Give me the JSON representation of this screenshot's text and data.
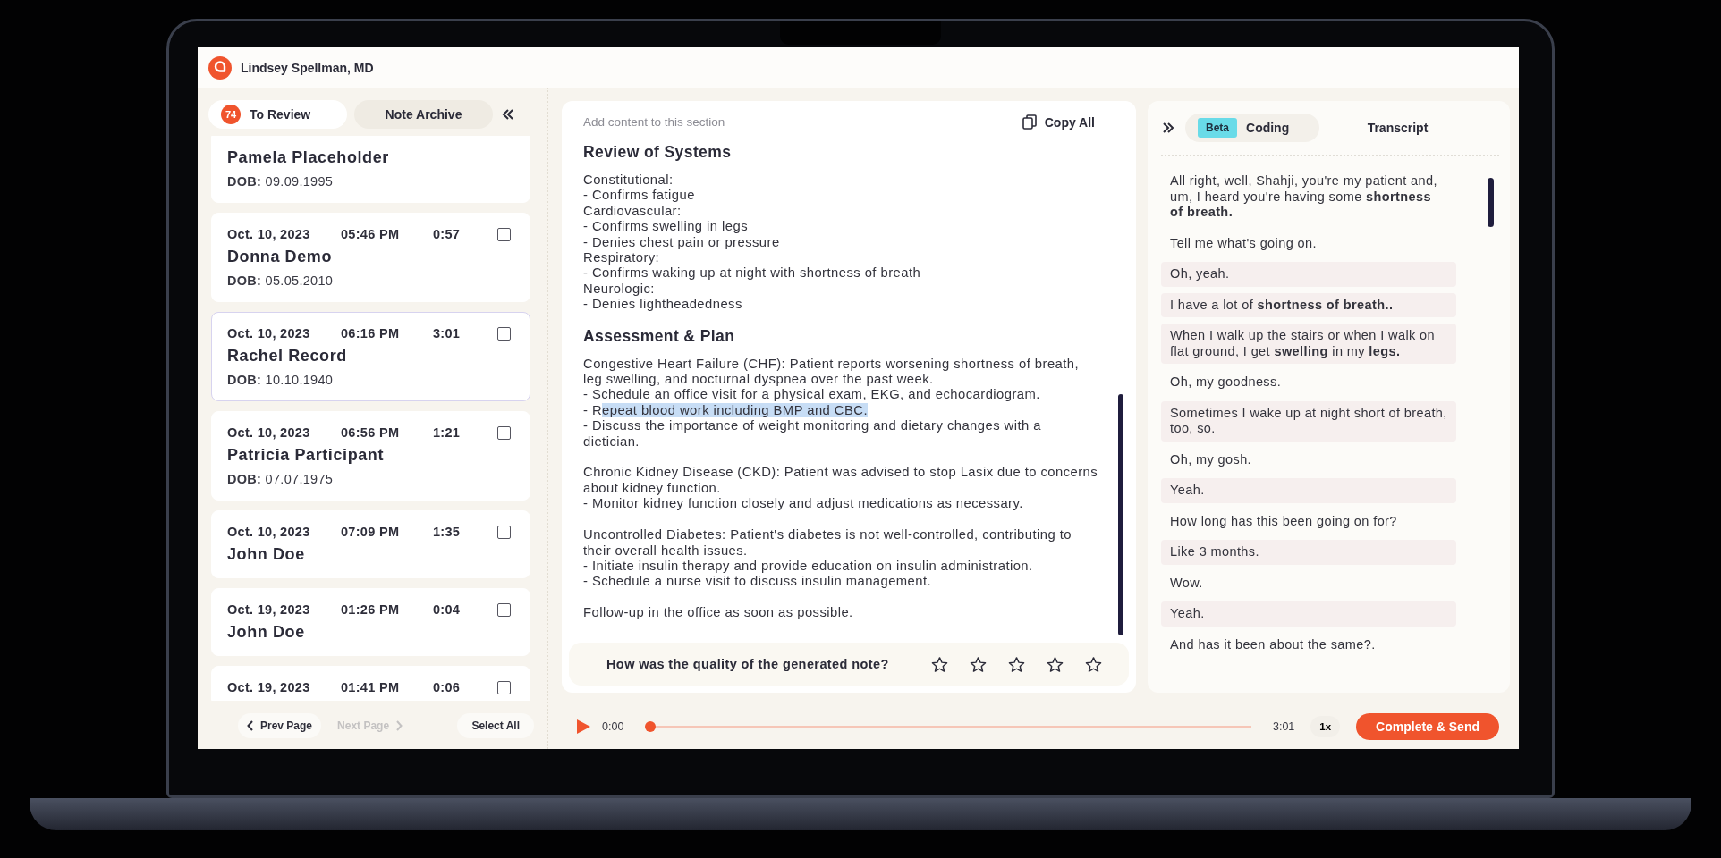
{
  "header": {
    "user_name": "Lindsey Spellman, MD"
  },
  "left_panel": {
    "tabs": [
      {
        "label": "To Review",
        "badge": "74",
        "selected": true
      },
      {
        "label": "Note Archive",
        "selected": false
      }
    ],
    "patients": [
      {
        "name": "Pamela Placeholder",
        "dob_label": "DOB:",
        "dob": "09.09.1995",
        "selected": false
      },
      {
        "date": "Oct. 10, 2023",
        "time": "05:46 PM",
        "duration": "0:57",
        "checked": false,
        "name": "Donna Demo",
        "dob_label": "DOB:",
        "dob": "05.05.2010",
        "selected": false
      },
      {
        "date": "Oct. 10, 2023",
        "time": "06:16 PM",
        "duration": "3:01",
        "checked": false,
        "name": "Rachel Record",
        "dob_label": "DOB:",
        "dob": "10.10.1940",
        "selected": true
      },
      {
        "date": "Oct. 10, 2023",
        "time": "06:56 PM",
        "duration": "1:21",
        "checked": false,
        "name": "Patricia Participant",
        "dob_label": "DOB:",
        "dob": "07.07.1975",
        "selected": false
      },
      {
        "date": "Oct. 10, 2023",
        "time": "07:09 PM",
        "duration": "1:35",
        "checked": false,
        "name": "John Doe",
        "selected": false
      },
      {
        "date": "Oct. 19, 2023",
        "time": "01:26 PM",
        "duration": "0:04",
        "checked": false,
        "name": "John Doe",
        "selected": false
      },
      {
        "date": "Oct. 19, 2023",
        "time": "01:41 PM",
        "duration": "0:06",
        "checked": false,
        "selected": false
      }
    ],
    "pager": {
      "prev": {
        "label": "Prev Page",
        "disabled": false
      },
      "next": {
        "label": "Next Page",
        "disabled": true
      },
      "select_all": "Select All"
    }
  },
  "note": {
    "placeholder": "Add content to this section",
    "copy_label": "Copy All",
    "sections": [
      {
        "heading": "Review of Systems",
        "paragraphs": [
          [
            "Constitutional:",
            "- Confirms fatigue",
            "Cardiovascular:",
            "- Confirms swelling in legs",
            "- Denies chest pain or pressure",
            "Respiratory:",
            "- Confirms waking up at night with shortness of breath",
            "Neurologic:",
            "- Denies lightheadedness"
          ]
        ]
      },
      {
        "heading": "Assessment & Plan",
        "paragraphs": [
          [
            "Congestive Heart Failure (CHF): Patient reports worsening shortness of breath, leg swelling, and nocturnal dyspnea over the past week.",
            "- Schedule an office visit for a physical exam, EKG, and echocardiogram.",
            {
              "text": "- R",
              "highlighted_text": "epeat blood work including BMP and CBC."
            },
            "- Discuss the importance of weight monitoring and dietary changes with a dietician."
          ],
          [
            "Chronic Kidney Disease (CKD): Patient was advised to stop Lasix due to concerns about kidney function.",
            "- Monitor kidney function closely and adjust medications as necessary."
          ],
          [
            "Uncontrolled Diabetes: Patient's diabetes is not well-controlled, contributing to their overall health issues.",
            "- Initiate insulin therapy and provide education on insulin administration.",
            "- Schedule a nurse visit to discuss insulin management."
          ],
          [
            "Follow-up in the office as soon as possible."
          ]
        ]
      }
    ],
    "rating": {
      "question": "How was the quality of the generated note?",
      "stars": 0
    }
  },
  "right_panel": {
    "tabs": [
      {
        "label": "Coding",
        "badge": "Beta",
        "selected": false
      },
      {
        "label": "Transcript",
        "selected": true
      }
    ],
    "transcript": [
      {
        "kind": "clinician",
        "text": "All right, well, Shahji, you're my patient and, um, I heard you're having some **shortness of breath.**"
      },
      {
        "kind": "clinician",
        "text": "Tell me what's going on."
      },
      {
        "kind": "patient",
        "text": "Oh, yeah."
      },
      {
        "kind": "patient",
        "text": "I have a lot of **shortness of breath..**"
      },
      {
        "kind": "patient",
        "text": "When I walk up the stairs or when I walk on flat ground, I get **swelling** in my **legs.**"
      },
      {
        "kind": "clinician",
        "text": "Oh, my goodness."
      },
      {
        "kind": "patient",
        "text": "Sometimes I wake up at night short of breath, too, so."
      },
      {
        "kind": "clinician",
        "text": "Oh, my gosh."
      },
      {
        "kind": "patient",
        "text": "Yeah."
      },
      {
        "kind": "clinician",
        "text": "How long has this been going on for?"
      },
      {
        "kind": "patient",
        "text": "Like 3 months."
      },
      {
        "kind": "clinician",
        "text": "Wow."
      },
      {
        "kind": "patient",
        "text": "Yeah."
      },
      {
        "kind": "clinician",
        "text": "And has it been about the same?."
      }
    ]
  },
  "player": {
    "current": "0:00",
    "level": 0,
    "total": "3:01",
    "speed": "1x",
    "action": "Complete & Send"
  }
}
